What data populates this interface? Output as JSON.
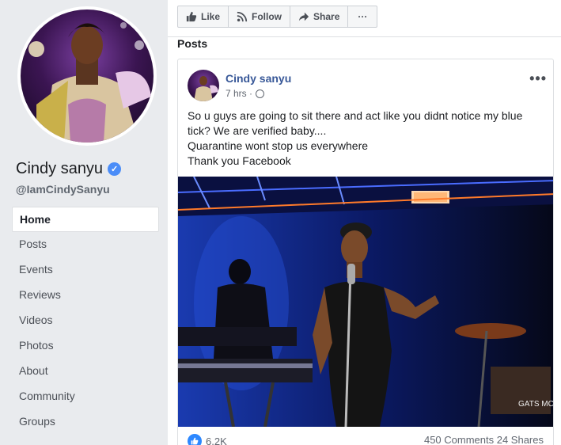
{
  "profile": {
    "name": "Cindy sanyu",
    "handle": "@IamCindySanyu"
  },
  "nav": {
    "items": [
      {
        "label": "Home",
        "active": true
      },
      {
        "label": "Posts"
      },
      {
        "label": "Events"
      },
      {
        "label": "Reviews"
      },
      {
        "label": "Videos"
      },
      {
        "label": "Photos"
      },
      {
        "label": "About"
      },
      {
        "label": "Community"
      },
      {
        "label": "Groups"
      }
    ]
  },
  "actions": {
    "like": "Like",
    "follow": "Follow",
    "share": "Share",
    "more": "···"
  },
  "section_title": "Posts",
  "post": {
    "author": "Cindy sanyu",
    "time": "7 hrs · ",
    "lines": [
      "So u guys are going to sit there and act like you didnt notice my blue tick? We are verified baby....",
      "Quarantine wont stop us everywhere",
      "Thank you Facebook"
    ],
    "reaction_count": "6.2K",
    "comments_shares": "450 Comments  24 Shares",
    "image_watermark": "GATS MC"
  },
  "colors": {
    "link_blue": "#385898",
    "verified_blue": "#4b8df8",
    "background": "#e9ebee"
  }
}
